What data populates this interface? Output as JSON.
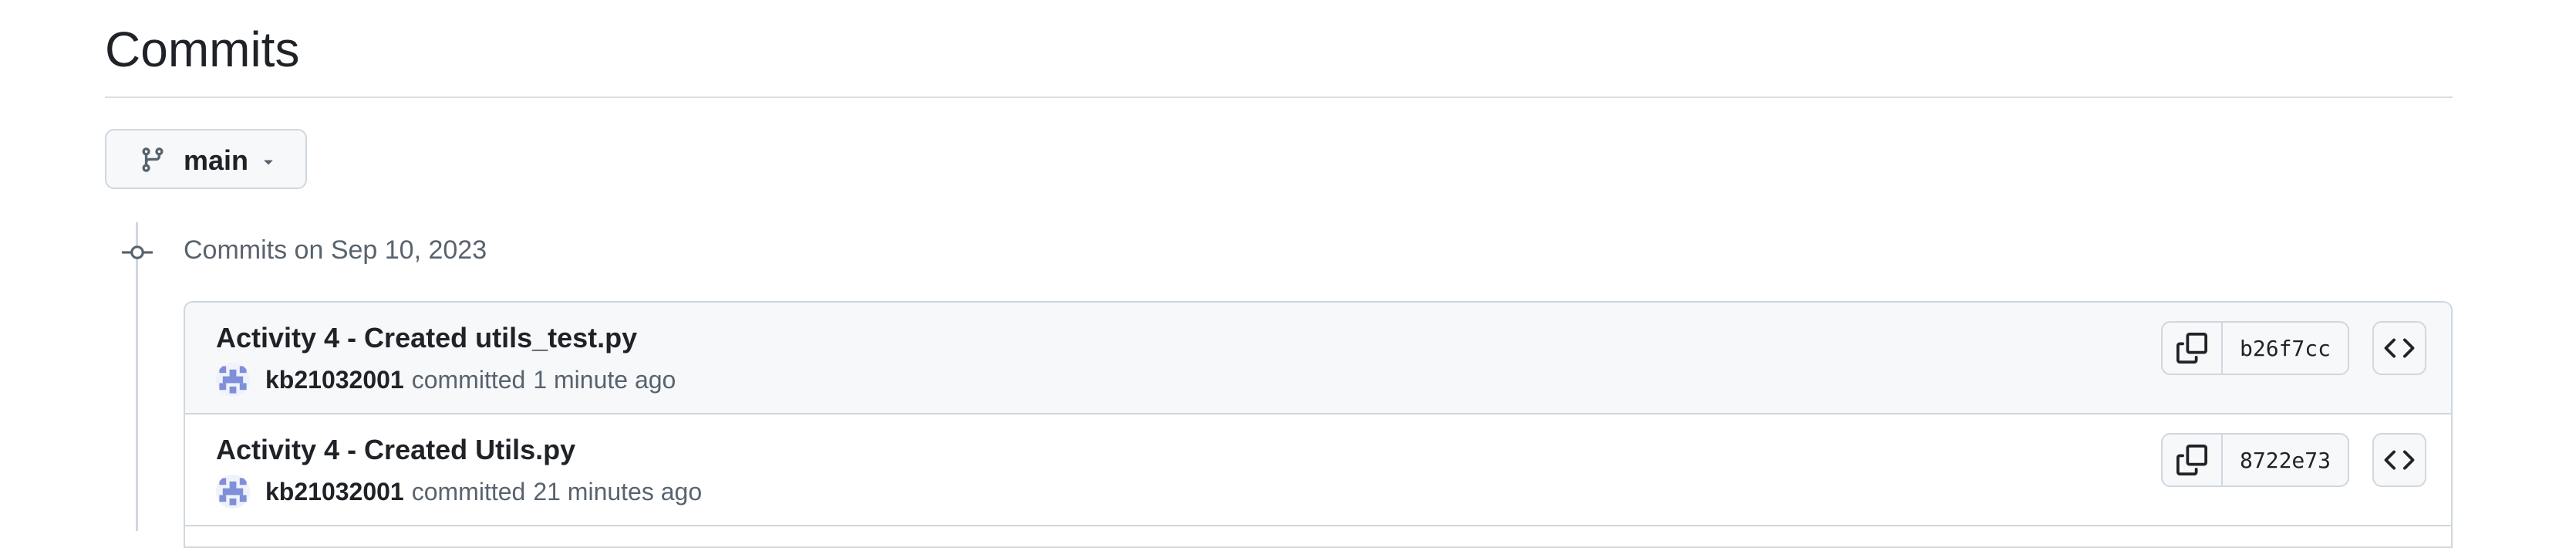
{
  "page": {
    "title": "Commits"
  },
  "branch_selector": {
    "label": "main",
    "icon": "git-branch-icon"
  },
  "commit_group": {
    "heading": "Commits on Sep 10, 2023",
    "commits": [
      {
        "message": "Activity 4 - Created utils_test.py",
        "author": "kb21032001",
        "action": "committed",
        "time": "1 minute ago",
        "sha": "b26f7cc"
      },
      {
        "message": "Activity 4 - Created Utils.py",
        "author": "kb21032001",
        "action": "committed",
        "time": "21 minutes ago",
        "sha": "8722e73"
      }
    ]
  },
  "colors": {
    "border": "#d0d7de",
    "muted_text": "#59636e",
    "row_highlight": "#f6f8fa",
    "avatar": "#7f8fd9"
  }
}
